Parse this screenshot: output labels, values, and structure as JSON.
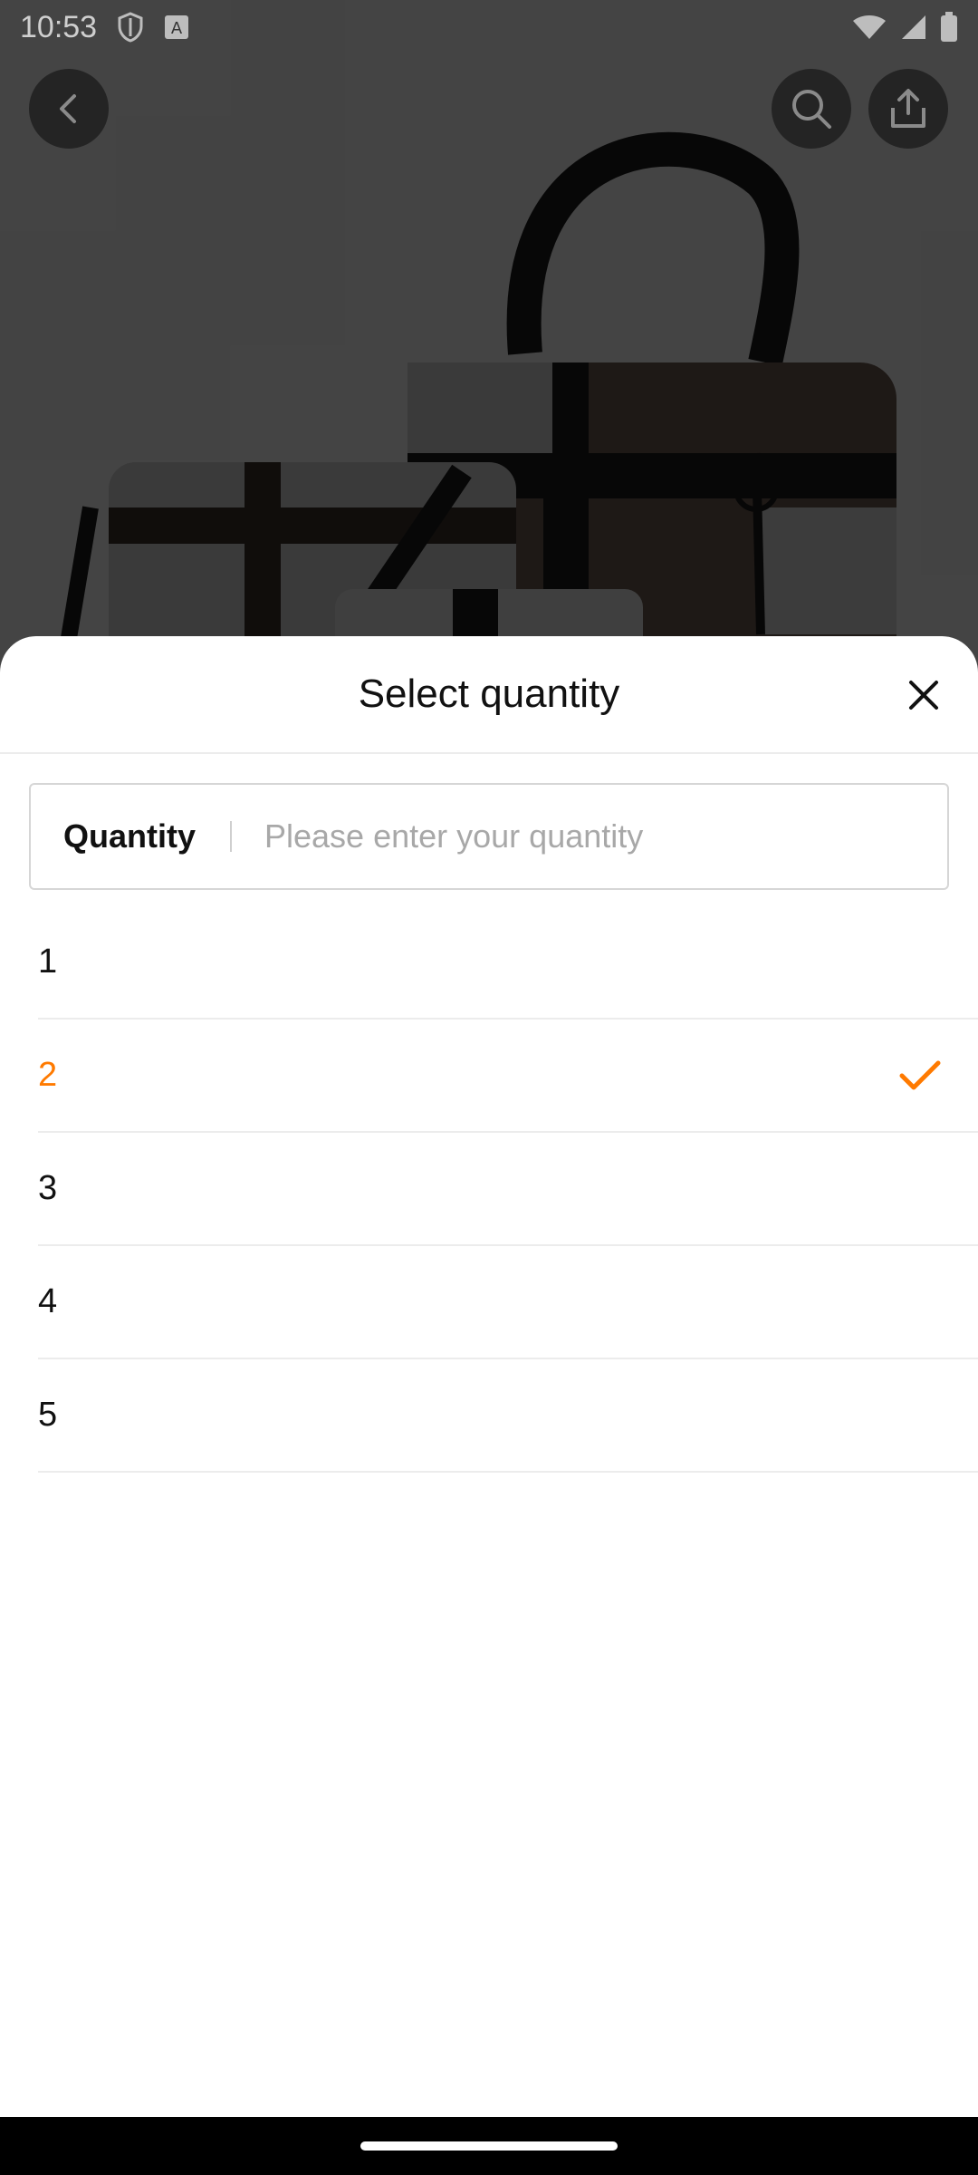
{
  "status_bar": {
    "time": "10:53",
    "icons": [
      "shield-icon",
      "notification-a-icon",
      "wifi-icon",
      "signal-icon",
      "battery-icon"
    ]
  },
  "top_bar": {
    "icons": [
      "back-arrow-icon",
      "search-icon",
      "share-icon"
    ]
  },
  "sheet": {
    "title": "Select quantity",
    "close_icon": "close-icon",
    "quantity_field": {
      "label": "Quantity",
      "value": "",
      "placeholder": "Please enter your quantity"
    },
    "options": [
      {
        "label": "1",
        "selected": false
      },
      {
        "label": "2",
        "selected": true
      },
      {
        "label": "3",
        "selected": false
      },
      {
        "label": "4",
        "selected": false
      },
      {
        "label": "5",
        "selected": false
      }
    ],
    "check_icon": "checkmark-icon"
  },
  "colors": {
    "accent": "#ff7a00",
    "text": "#111111",
    "placeholder": "#a8a8a8",
    "divider": "#ececec"
  }
}
